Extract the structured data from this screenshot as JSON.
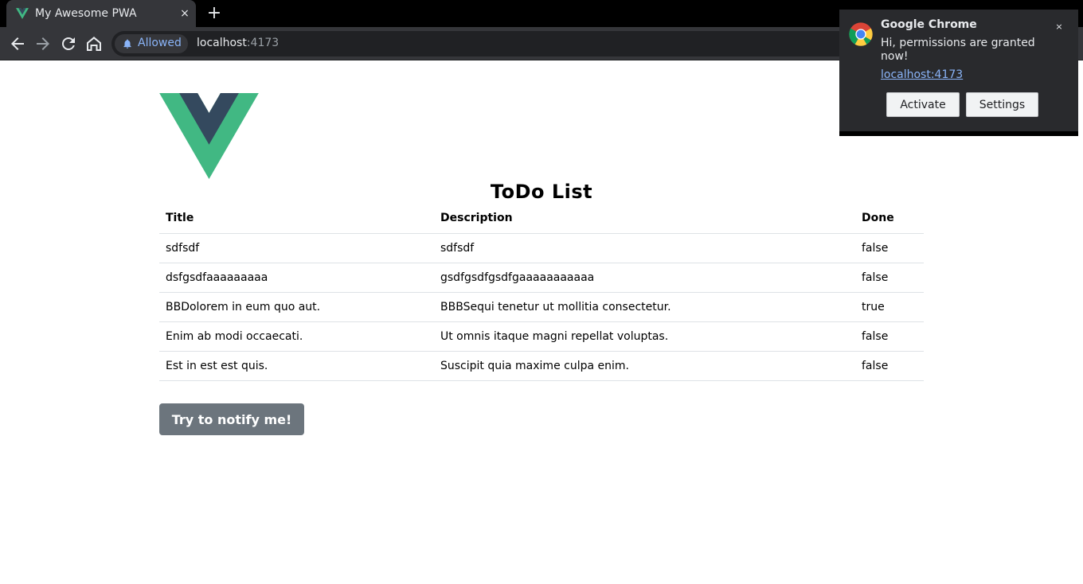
{
  "browser": {
    "tab": {
      "title": "My Awesome PWA",
      "favicon": "vue-icon",
      "close": "×"
    },
    "new_tab": "+",
    "permission_chip": {
      "icon": "bell-icon",
      "label": "Allowed"
    },
    "url": {
      "host": "localhost",
      "port": ":4173"
    }
  },
  "notification": {
    "source": "Google Chrome",
    "message": "Hi, permissions are granted now!",
    "link": "localhost:4173",
    "close": "×",
    "actions": {
      "activate": "Activate",
      "settings": "Settings"
    }
  },
  "page": {
    "logo": "vue-logo",
    "title": "ToDo List",
    "table": {
      "headers": {
        "title": "Title",
        "description": "Description",
        "done": "Done"
      },
      "rows": [
        {
          "title": "sdfsdf",
          "description": "sdfsdf",
          "done": "false"
        },
        {
          "title": "dsfgsdfaaaaaaaaa",
          "description": "gsdfgsdfgsdfgaaaaaaaaaaa",
          "done": "false"
        },
        {
          "title": "BBDolorem in eum quo aut.",
          "description": "BBBSequi tenetur ut mollitia consectetur.",
          "done": "true"
        },
        {
          "title": "Enim ab modi occaecati.",
          "description": "Ut omnis itaque magni repellat voluptas.",
          "done": "false"
        },
        {
          "title": "Est in est est quis.",
          "description": "Suscipit quia maxime culpa enim.",
          "done": "false"
        }
      ]
    },
    "notify_button": "Try to notify me!"
  },
  "colors": {
    "vue_green": "#41b883",
    "vue_dark": "#34495e",
    "button_gray": "#6c757d",
    "link_blue": "#8ab4f8"
  }
}
